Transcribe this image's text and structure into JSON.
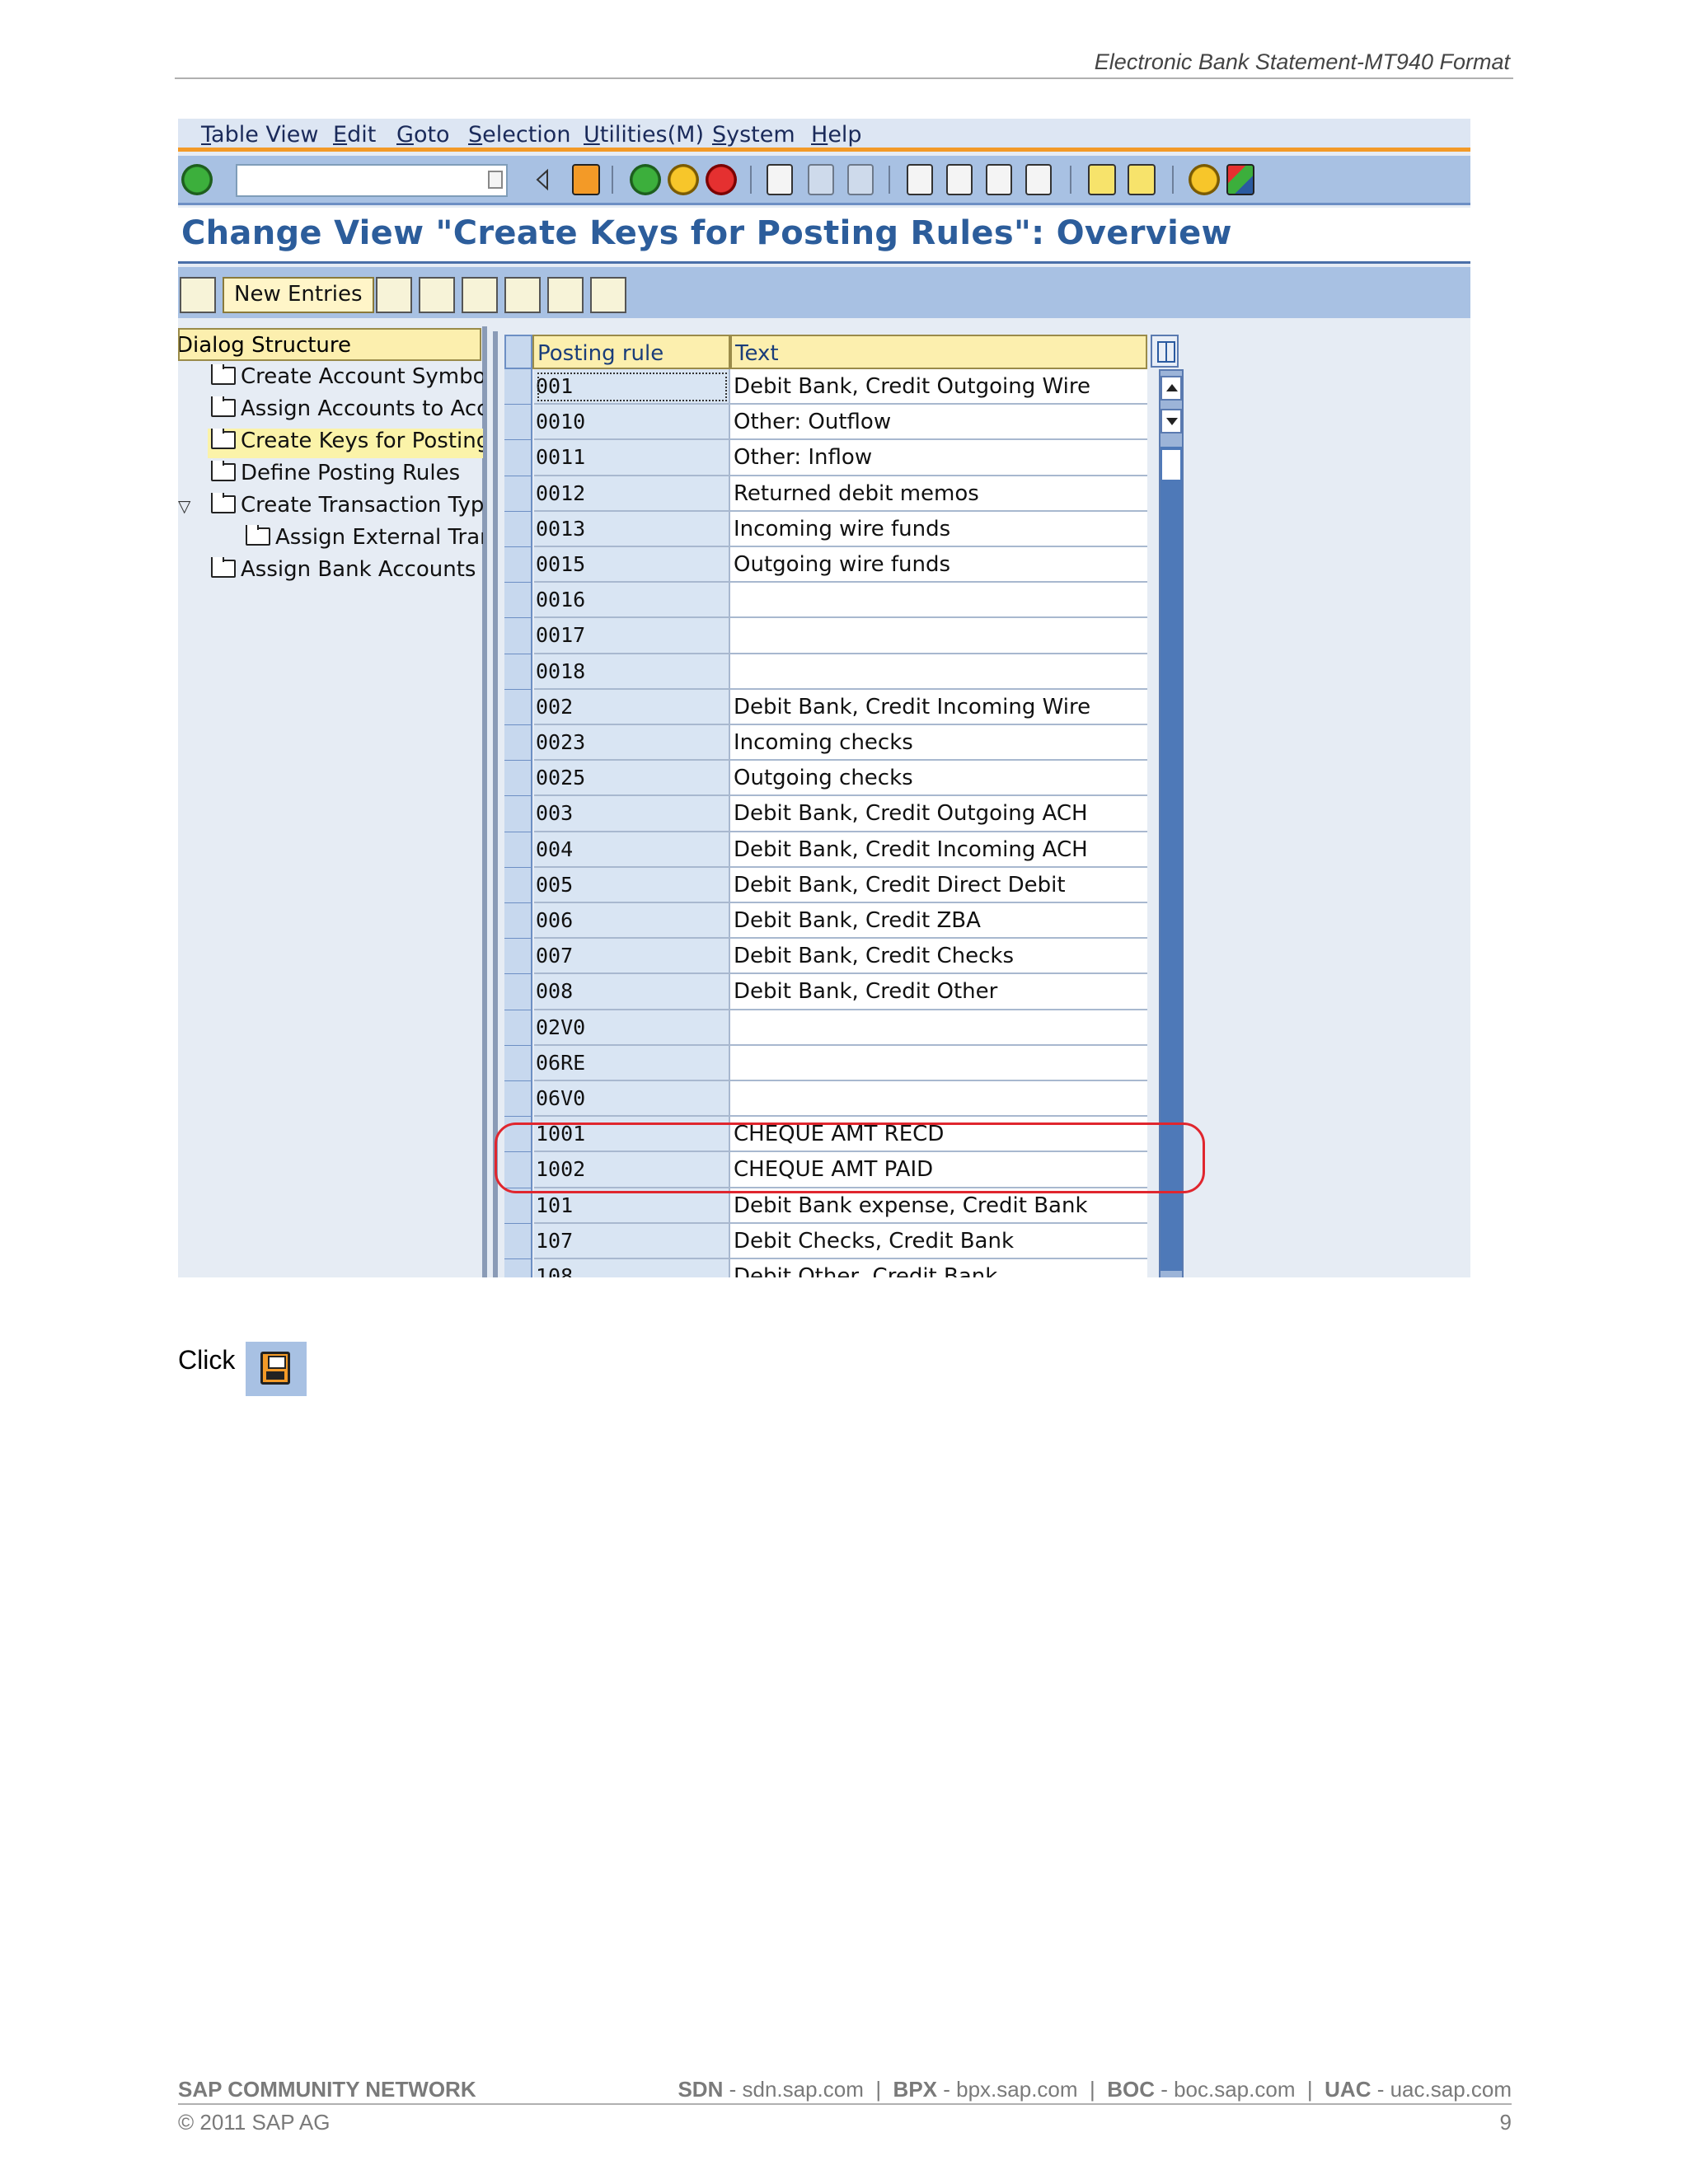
{
  "document": {
    "header_title": "Electronic Bank Statement-MT940 Format",
    "click_label": "Click",
    "footer": {
      "brand": "SAP COMMUNITY NETWORK",
      "links": [
        {
          "abbr": "SDN",
          "url": "sdn.sap.com"
        },
        {
          "abbr": "BPX",
          "url": "bpx.sap.com"
        },
        {
          "abbr": "BOC",
          "url": "boc.sap.com"
        },
        {
          "abbr": "UAC",
          "url": "uac.sap.com"
        }
      ],
      "copyright": "© 2011 SAP AG",
      "page_number": "9"
    }
  },
  "sap": {
    "menu": [
      "Table View",
      "Edit",
      "Goto",
      "Selection",
      "Utilities(M)",
      "System",
      "Help"
    ],
    "command_field": {
      "value": "",
      "placeholder": ""
    },
    "title": "Change View \"Create Keys for Posting Rules\": Overview",
    "app_toolbar": {
      "new_entries_label": "New Entries"
    },
    "tree": {
      "header": "Dialog Structure",
      "items": [
        {
          "label": "Create Account Symbols",
          "level": 1,
          "selected": false
        },
        {
          "label": "Assign Accounts to Acco",
          "level": 1,
          "selected": false
        },
        {
          "label": "Create Keys for Posting I",
          "level": 1,
          "selected": true
        },
        {
          "label": "Define Posting Rules",
          "level": 1,
          "selected": false
        },
        {
          "label": "Create Transaction Type",
          "level": 1,
          "selected": false,
          "expanded": true
        },
        {
          "label": "Assign External Tran",
          "level": 2,
          "selected": false
        },
        {
          "label": "Assign Bank Accounts to",
          "level": 1,
          "selected": false
        }
      ]
    },
    "table": {
      "columns": [
        "Posting rule",
        "Text"
      ],
      "rows": [
        {
          "rule": "001",
          "text": "Debit Bank, Credit Outgoing Wire"
        },
        {
          "rule": "0010",
          "text": "Other: Outflow"
        },
        {
          "rule": "0011",
          "text": "Other: Inflow"
        },
        {
          "rule": "0012",
          "text": "Returned debit memos"
        },
        {
          "rule": "0013",
          "text": "Incoming wire funds"
        },
        {
          "rule": "0015",
          "text": "Outgoing wire funds"
        },
        {
          "rule": "0016",
          "text": ""
        },
        {
          "rule": "0017",
          "text": ""
        },
        {
          "rule": "0018",
          "text": ""
        },
        {
          "rule": "002",
          "text": "Debit Bank, Credit Incoming Wire"
        },
        {
          "rule": "0023",
          "text": "Incoming checks"
        },
        {
          "rule": "0025",
          "text": "Outgoing checks"
        },
        {
          "rule": "003",
          "text": "Debit Bank, Credit Outgoing ACH"
        },
        {
          "rule": "004",
          "text": "Debit Bank, Credit Incoming ACH"
        },
        {
          "rule": "005",
          "text": "Debit Bank, Credit Direct Debit"
        },
        {
          "rule": "006",
          "text": "Debit Bank, Credit ZBA"
        },
        {
          "rule": "007",
          "text": "Debit Bank, Credit Checks"
        },
        {
          "rule": "008",
          "text": "Debit Bank, Credit Other"
        },
        {
          "rule": "02V0",
          "text": ""
        },
        {
          "rule": "06RE",
          "text": ""
        },
        {
          "rule": "06V0",
          "text": ""
        },
        {
          "rule": "1001",
          "text": "CHEQUE AMT RECD"
        },
        {
          "rule": "1002",
          "text": "CHEQUE AMT PAID"
        },
        {
          "rule": "101",
          "text": "Debit Bank expense, Credit Bank"
        },
        {
          "rule": "107",
          "text": "Debit Checks, Credit Bank"
        },
        {
          "rule": "108",
          "text": "Debit Other, Credit Bank"
        }
      ]
    },
    "colors": {
      "menu_underline": "#f39a27",
      "toolbar_bg": "#a8c1e3",
      "title_color": "#2c5d9b",
      "highlight_color": "#e0262e"
    }
  }
}
